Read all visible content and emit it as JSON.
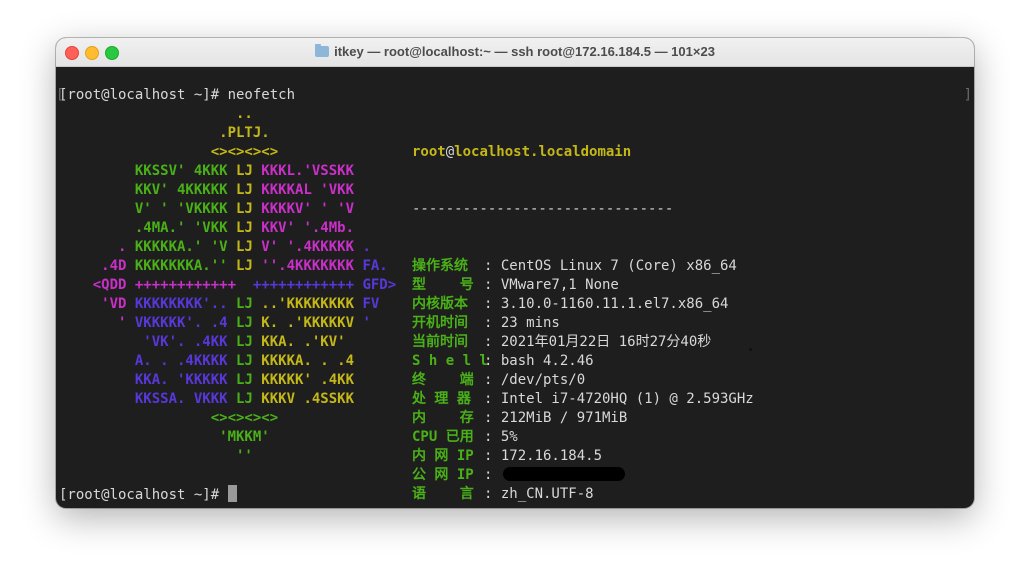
{
  "window": {
    "title": "itkey — root@localhost:~ — ssh root@172.16.184.5 — 101×23"
  },
  "terminal": {
    "prompt1": "[root@localhost ~]# neofetch",
    "prompt2": "[root@localhost ~]# ",
    "logo_colors": {
      "yellow": "#c4b818",
      "green": "#4ab018",
      "magenta": "#c830c8",
      "blue": "#5838d8"
    },
    "logo": [
      [
        {
          "t": "                     ..",
          "c": "y"
        }
      ],
      [
        {
          "t": "                   .PLTJ.",
          "c": "y"
        }
      ],
      [
        {
          "t": "                  <><><><>",
          "c": "y"
        }
      ],
      [
        {
          "t": "         KKSSV' 4KKK ",
          "c": "g"
        },
        {
          "t": "LJ",
          "c": "y"
        },
        {
          "t": " KKKL.'VSSKK",
          "c": "m"
        }
      ],
      [
        {
          "t": "         KKV' 4KKKKK ",
          "c": "g"
        },
        {
          "t": "LJ",
          "c": "y"
        },
        {
          "t": " KKKKAL 'VKK",
          "c": "m"
        }
      ],
      [
        {
          "t": "         V' ' 'VKKKK ",
          "c": "g"
        },
        {
          "t": "LJ",
          "c": "y"
        },
        {
          "t": " KKKKV' ' 'V",
          "c": "m"
        }
      ],
      [
        {
          "t": "         .4MA.' 'VKK ",
          "c": "g"
        },
        {
          "t": "LJ",
          "c": "y"
        },
        {
          "t": " KKV' '.4Mb.",
          "c": "m"
        }
      ],
      [
        {
          "t": "       . ",
          "c": "m"
        },
        {
          "t": "KKKKKA.' 'V ",
          "c": "g"
        },
        {
          "t": "LJ",
          "c": "y"
        },
        {
          "t": " V' '.4KKKKK ",
          "c": "m"
        },
        {
          "t": ".",
          "c": "b"
        }
      ],
      [
        {
          "t": "     .4D ",
          "c": "m"
        },
        {
          "t": "KKKKKKKA.'' ",
          "c": "g"
        },
        {
          "t": "LJ",
          "c": "y"
        },
        {
          "t": " ''.4KKKKKKK ",
          "c": "m"
        },
        {
          "t": "FA.",
          "c": "b"
        }
      ],
      [
        {
          "t": "    <QDD ",
          "c": "m"
        },
        {
          "t": "++++++++++++  ",
          "c": "m"
        },
        {
          "t": "++++++++++++ ",
          "c": "b"
        },
        {
          "t": "GFD>",
          "c": "b"
        }
      ],
      [
        {
          "t": "     'VD ",
          "c": "m"
        },
        {
          "t": "KKKKKKKK'.. ",
          "c": "b"
        },
        {
          "t": "LJ",
          "c": "g"
        },
        {
          "t": " ..'KKKKKKKK ",
          "c": "y"
        },
        {
          "t": "FV",
          "c": "b"
        }
      ],
      [
        {
          "t": "       ' ",
          "c": "m"
        },
        {
          "t": "VKKKKK'. .4 ",
          "c": "b"
        },
        {
          "t": "LJ",
          "c": "g"
        },
        {
          "t": " K. .'KKKKKV ",
          "c": "y"
        },
        {
          "t": "'",
          "c": "b"
        }
      ],
      [
        {
          "t": "          'VK'. .4KK ",
          "c": "b"
        },
        {
          "t": "LJ",
          "c": "g"
        },
        {
          "t": " KKA. .'KV'",
          "c": "y"
        }
      ],
      [
        {
          "t": "         A. . .4KKKK ",
          "c": "b"
        },
        {
          "t": "LJ",
          "c": "g"
        },
        {
          "t": " KKKKA. . .4",
          "c": "y"
        }
      ],
      [
        {
          "t": "         KKA. 'KKKKK ",
          "c": "b"
        },
        {
          "t": "LJ",
          "c": "g"
        },
        {
          "t": " KKKKK' .4KK",
          "c": "y"
        }
      ],
      [
        {
          "t": "         KKSSA. VKKK ",
          "c": "b"
        },
        {
          "t": "LJ",
          "c": "g"
        },
        {
          "t": " KKKV .4SSKK",
          "c": "y"
        }
      ],
      [
        {
          "t": "                  <><><><>",
          "c": "g"
        }
      ],
      [
        {
          "t": "                   'MKKM'",
          "c": "g"
        }
      ],
      [
        {
          "t": "                     ''",
          "c": "g"
        }
      ]
    ],
    "info": {
      "user": "root",
      "at": "@",
      "host": "localhost.localdomain",
      "separator": "-------------------------------",
      "rows": [
        {
          "key": "操作系统",
          "value": "CentOS Linux 7 (Core) x86_64"
        },
        {
          "key": "型    号",
          "value": "VMware7,1 None"
        },
        {
          "key": "内核版本",
          "value": "3.10.0-1160.11.1.el7.x86_64"
        },
        {
          "key": "开机时间",
          "value": "23 mins"
        },
        {
          "key": "当前时间",
          "value": "2021年01月22日 16时27分40秒"
        },
        {
          "key": "S h e l l",
          "value": "bash 4.2.46"
        },
        {
          "key": "终    端",
          "value": "/dev/pts/0"
        },
        {
          "key": "处 理 器",
          "value": "Intel i7-4720HQ (1) @ 2.593GHz"
        },
        {
          "key": "内    存",
          "value": "212MiB / 971MiB"
        },
        {
          "key": "CPU 已用",
          "value": "5%"
        },
        {
          "key": "内 网 IP",
          "value": "172.16.184.5"
        },
        {
          "key": "公 网 IP",
          "value": ""
        },
        {
          "key": "语    言",
          "value": "zh_CN.UTF-8"
        }
      ]
    }
  }
}
